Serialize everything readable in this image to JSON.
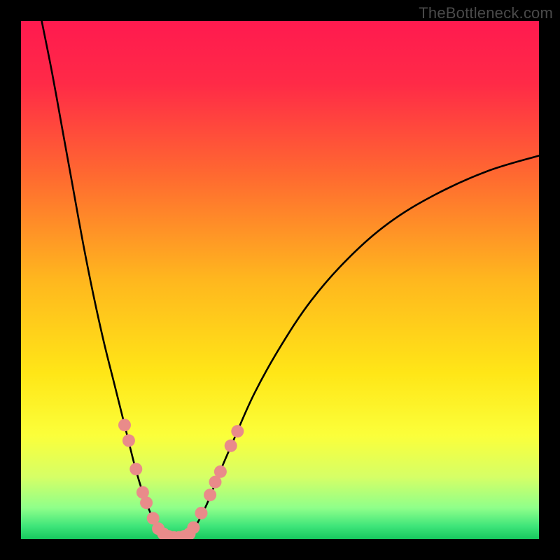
{
  "watermark": "TheBottleneck.com",
  "chart_data": {
    "type": "line",
    "title": "",
    "xlabel": "",
    "ylabel": "",
    "xlim": [
      0,
      100
    ],
    "ylim": [
      0,
      100
    ],
    "grid": false,
    "gradient_stops": [
      {
        "offset": 0.0,
        "color": "#ff1a4f"
      },
      {
        "offset": 0.12,
        "color": "#ff2a47"
      },
      {
        "offset": 0.3,
        "color": "#ff6a30"
      },
      {
        "offset": 0.5,
        "color": "#ffb71e"
      },
      {
        "offset": 0.68,
        "color": "#ffe617"
      },
      {
        "offset": 0.8,
        "color": "#fbff3a"
      },
      {
        "offset": 0.88,
        "color": "#d6ff66"
      },
      {
        "offset": 0.94,
        "color": "#8fff8a"
      },
      {
        "offset": 0.975,
        "color": "#3fe57a"
      },
      {
        "offset": 1.0,
        "color": "#17c85e"
      }
    ],
    "series": [
      {
        "name": "left-branch",
        "x": [
          4,
          6,
          8,
          10,
          12,
          14,
          16,
          18,
          20,
          22,
          23.5,
          25,
          26.5,
          28
        ],
        "y": [
          100,
          90,
          79,
          68,
          57,
          47,
          38,
          30,
          22,
          14,
          9,
          5,
          2,
          0.5
        ]
      },
      {
        "name": "floor",
        "x": [
          28,
          30,
          32
        ],
        "y": [
          0.5,
          0.3,
          0.5
        ]
      },
      {
        "name": "right-branch",
        "x": [
          32,
          34,
          36,
          38,
          41,
          45,
          50,
          56,
          63,
          71,
          80,
          90,
          100
        ],
        "y": [
          0.5,
          3,
          7,
          12,
          19,
          28,
          37,
          46,
          54,
          61,
          66.5,
          71,
          74
        ]
      }
    ],
    "markers": {
      "color": "#e98b8a",
      "radius_px": 9,
      "points": [
        {
          "x": 20.0,
          "y": 22.0
        },
        {
          "x": 20.8,
          "y": 19.0
        },
        {
          "x": 22.2,
          "y": 13.5
        },
        {
          "x": 23.5,
          "y": 9.0
        },
        {
          "x": 24.2,
          "y": 7.0
        },
        {
          "x": 25.5,
          "y": 4.0
        },
        {
          "x": 26.5,
          "y": 2.0
        },
        {
          "x": 27.5,
          "y": 1.0
        },
        {
          "x": 28.5,
          "y": 0.5
        },
        {
          "x": 29.5,
          "y": 0.3
        },
        {
          "x": 30.5,
          "y": 0.3
        },
        {
          "x": 31.5,
          "y": 0.5
        },
        {
          "x": 32.5,
          "y": 1.0
        },
        {
          "x": 33.3,
          "y": 2.2
        },
        {
          "x": 34.8,
          "y": 5.0
        },
        {
          "x": 36.5,
          "y": 8.5
        },
        {
          "x": 37.5,
          "y": 11.0
        },
        {
          "x": 38.5,
          "y": 13.0
        },
        {
          "x": 40.5,
          "y": 18.0
        },
        {
          "x": 41.8,
          "y": 20.8
        }
      ]
    }
  }
}
